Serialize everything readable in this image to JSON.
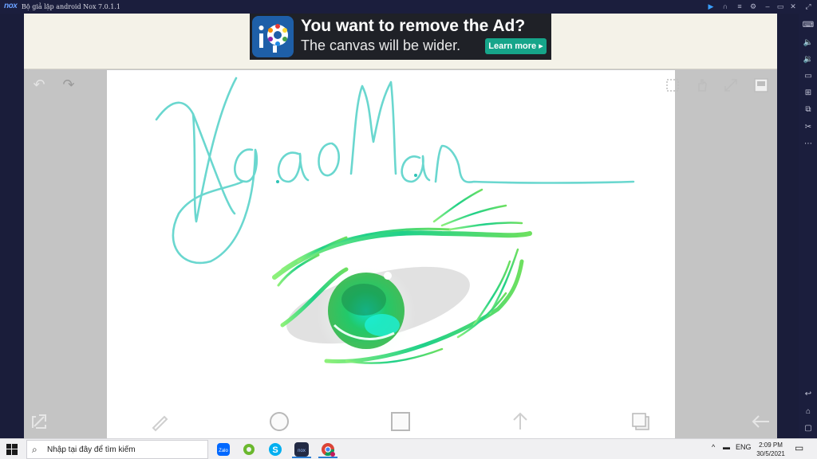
{
  "titlebar": {
    "logo": "nox",
    "title": "Bộ giả lập android Nox 7.0.1.1",
    "buttons": [
      "play-icon",
      "headset-icon",
      "menu-icon",
      "settings-icon",
      "minimize-icon",
      "restore-icon",
      "close-icon",
      "expand-icon"
    ]
  },
  "sidebar": {
    "items": [
      "keyboard-icon",
      "volume-up-icon",
      "volume-down-icon",
      "screen-icon",
      "add-apk-icon",
      "multi-instance-icon",
      "scissors-icon",
      "more-icon",
      "back-icon",
      "home-icon",
      "recent-apps-icon"
    ]
  },
  "ad": {
    "headline": "You want to remove the Ad?",
    "subline": "The canvas will be wider.",
    "cta": "Learn more"
  },
  "drawing": {
    "signature": "NgaoMan"
  },
  "taskbar": {
    "search_placeholder": "Nhập tại đây để tìm kiếm",
    "apps": [
      {
        "name": "zalo",
        "label": "Zalo",
        "color": "#0068ff"
      },
      {
        "name": "greenshot",
        "label": "",
        "color": "#6ab82e"
      },
      {
        "name": "skype",
        "label": "S",
        "color": "#00aff0"
      },
      {
        "name": "nox",
        "label": "nox",
        "color": "#222a44"
      },
      {
        "name": "chrome",
        "label": "",
        "color": "#db4437"
      }
    ],
    "lang": "ENG",
    "time": "2:09 PM",
    "date": "30/5/2021"
  },
  "colors": {
    "accent_teal": "#5fd6c8",
    "ad_button": "#16a58a",
    "eye_green": "#22d36a"
  }
}
